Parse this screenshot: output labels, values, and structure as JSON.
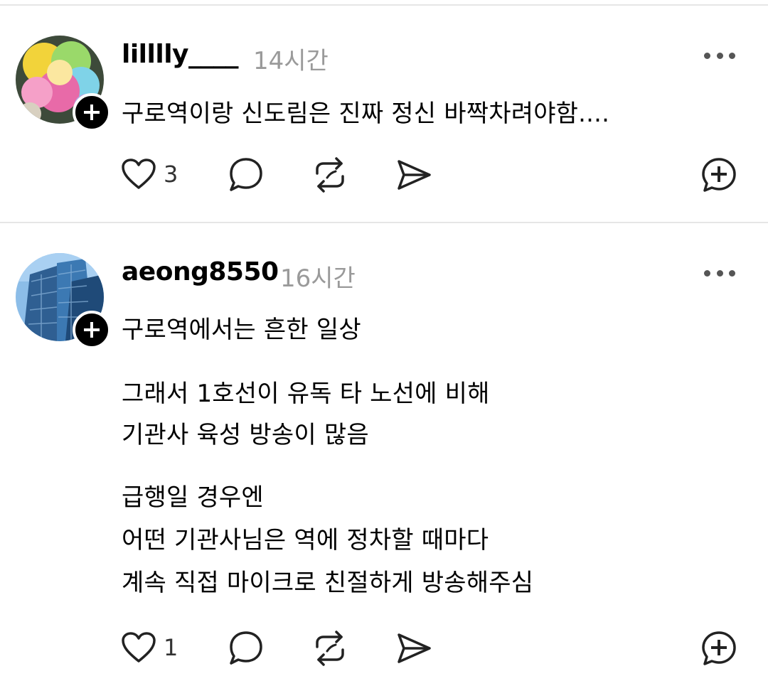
{
  "posts": [
    {
      "username": "lilllly____",
      "time": "14시간",
      "lines": [
        "구로역이랑 신도림은 진짜 정신 바짝차려야함...."
      ],
      "likes": "3",
      "avatar_icon": "flower-avatar",
      "colors": {
        "petal1": "#f2d33a",
        "petal2": "#e86aa8",
        "petal3": "#7fd3e8",
        "petal4": "#9ad96a"
      }
    },
    {
      "username": "aeong8550",
      "time": "16시간",
      "lines": [
        "구로역에서는 흔한 일상",
        "그래서 1호선이 유독 타 노선에 비해",
        "기관사 육성 방송이 많음",
        "급행일 경우엔",
        "어떤 기관사님은 역에 정차할 때마다",
        "계속 직접 마이크로 친절하게 방송해주심"
      ],
      "likes": "1",
      "avatar_icon": "building-avatar",
      "colors": {
        "sky": "#6fa6d8",
        "glass": "#2f5f92"
      }
    }
  ],
  "icons": {
    "like": "heart-icon",
    "comment": "comment-bubble-icon",
    "repost": "repost-icon",
    "share": "send-icon",
    "quote": "add-circle-icon",
    "more": "more-dots-icon",
    "follow": "plus-icon"
  }
}
